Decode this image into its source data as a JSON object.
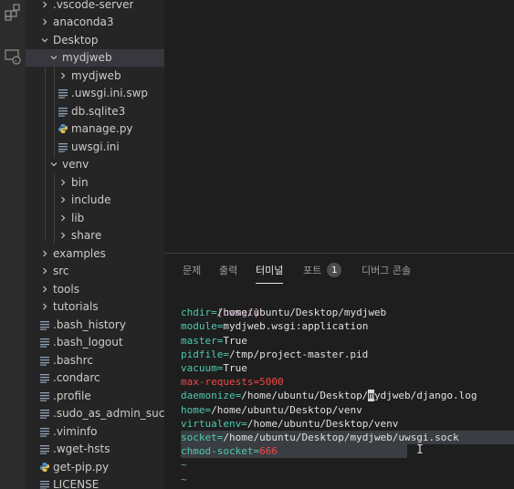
{
  "explorer": {
    "items": [
      {
        "label": ".vscode-server",
        "type": "folder",
        "expanded": false
      },
      {
        "label": "anaconda3",
        "type": "folder",
        "expanded": false
      },
      {
        "label": "Desktop",
        "type": "folder",
        "expanded": true
      },
      {
        "label": "mydjweb",
        "type": "folder",
        "expanded": true
      },
      {
        "label": "mydjweb",
        "type": "folder",
        "expanded": false
      },
      {
        "label": ".uwsgi.ini.swp",
        "type": "file"
      },
      {
        "label": "db.sqlite3",
        "type": "file"
      },
      {
        "label": "manage.py",
        "type": "python"
      },
      {
        "label": "uwsgi.ini",
        "type": "file"
      },
      {
        "label": "venv",
        "type": "folder",
        "expanded": true
      },
      {
        "label": "bin",
        "type": "folder",
        "expanded": false
      },
      {
        "label": "include",
        "type": "folder",
        "expanded": false
      },
      {
        "label": "lib",
        "type": "folder",
        "expanded": false
      },
      {
        "label": "share",
        "type": "folder",
        "expanded": false
      },
      {
        "label": "examples",
        "type": "folder",
        "expanded": false
      },
      {
        "label": "src",
        "type": "folder",
        "expanded": false
      },
      {
        "label": "tools",
        "type": "folder",
        "expanded": false
      },
      {
        "label": "tutorials",
        "type": "folder",
        "expanded": false
      },
      {
        "label": ".bash_history",
        "type": "file"
      },
      {
        "label": ".bash_logout",
        "type": "file"
      },
      {
        "label": ".bashrc",
        "type": "file"
      },
      {
        "label": ".condarc",
        "type": "file"
      },
      {
        "label": ".profile",
        "type": "file"
      },
      {
        "label": ".sudo_as_admin_succ...",
        "type": "file"
      },
      {
        "label": ".viminfo",
        "type": "file"
      },
      {
        "label": ".wget-hsts",
        "type": "file"
      },
      {
        "label": "get-pip.py",
        "type": "python"
      },
      {
        "label": "LICENSE",
        "type": "file"
      }
    ]
  },
  "panel": {
    "tabs": [
      {
        "label": "문제"
      },
      {
        "label": "출력"
      },
      {
        "label": "터미널"
      },
      {
        "label": "포트"
      },
      {
        "label": "디버그 콘솔"
      }
    ],
    "ports_badge": "1"
  },
  "terminal": {
    "section": "[uwsgi]",
    "lines": [
      {
        "key": "chdir",
        "value": "/home/ubuntu/Desktop/mydjweb"
      },
      {
        "key": "module",
        "value": "mydjweb.wsgi:application"
      },
      {
        "key": "master",
        "value": "True"
      },
      {
        "key": "pidfile",
        "value": "/tmp/project-master.pid"
      },
      {
        "key": "vacuum",
        "value": "True"
      },
      {
        "key": "max-requests",
        "value": "5000"
      },
      {
        "key": "daemonize",
        "value_before_cursor": "/home/ubuntu/Desktop/",
        "cursor_char": "m",
        "value_after_cursor": "ydjweb/django.log"
      },
      {
        "key": "home",
        "value": "/home/ubuntu/Desktop/venv"
      },
      {
        "key": "virtualenv",
        "value": "/home/ubuntu/Desktop/venv"
      },
      {
        "key": "socket",
        "value": "/home/ubuntu/Desktop/mydjweb/uwsgi.sock"
      },
      {
        "key": "chmod-socket",
        "value": "666"
      }
    ],
    "tilde": "~"
  },
  "colors": {
    "activity_bar": "#2c2c2c",
    "sidebar": "#252526",
    "editor": "#1e1e1e",
    "selection": "#37373d",
    "key": "#4ec9b0",
    "section": "#c586c0",
    "number": "#f44747"
  },
  "icons": {
    "activity_1": "extensions-icon",
    "activity_2": "remote-explorer-icon",
    "chevron_right": "chevron-right-icon",
    "chevron_down": "chevron-down-icon",
    "file": "file-lines-icon",
    "python": "python-icon"
  }
}
